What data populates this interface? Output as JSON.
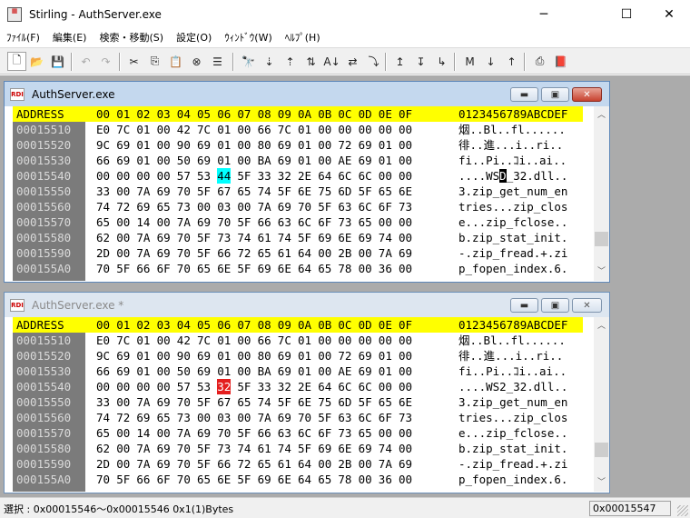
{
  "window": {
    "title": "Stirling - AuthServer.exe",
    "minimize_glyph": "─",
    "maximize_glyph": "☐",
    "close_glyph": "✕"
  },
  "menu": [
    "ﾌｧｲﾙ(F)",
    "編集(E)",
    "検索・移動(S)",
    "設定(O)",
    "ｳｨﾝﾄﾞｳ(W)",
    "ﾍﾙﾌﾟ(H)"
  ],
  "toolbar": {
    "buttons": [
      {
        "icon": "new-file-icon",
        "glyph": "🗋"
      },
      {
        "icon": "open-folder-icon",
        "glyph": "📂"
      },
      {
        "icon": "save-icon",
        "glyph": "💾"
      },
      {
        "icon": "undo-icon",
        "glyph": "↶"
      },
      {
        "icon": "redo-icon",
        "glyph": "↷"
      },
      {
        "icon": "cut-icon",
        "glyph": "✂"
      },
      {
        "icon": "copy-icon",
        "glyph": "⎘"
      },
      {
        "icon": "paste-icon",
        "glyph": "📋"
      },
      {
        "icon": "delete-icon",
        "glyph": "⊗"
      },
      {
        "icon": "list-icon",
        "glyph": "☰"
      },
      {
        "icon": "find-icon",
        "glyph": "🔭"
      },
      {
        "icon": "find-next-icon",
        "glyph": "⇣"
      },
      {
        "icon": "find-prev-icon",
        "glyph": "⇡"
      },
      {
        "icon": "find-all-icon",
        "glyph": "⇅"
      },
      {
        "icon": "replace-icon",
        "glyph": "A↓"
      },
      {
        "icon": "compare-icon",
        "glyph": "⇄"
      },
      {
        "icon": "jump-icon",
        "glyph": "⤵"
      },
      {
        "icon": "page-up-icon",
        "glyph": "↥"
      },
      {
        "icon": "page-down-icon",
        "glyph": "↧"
      },
      {
        "icon": "page-next-icon",
        "glyph": "↳"
      },
      {
        "icon": "mark-icon",
        "glyph": "M"
      },
      {
        "icon": "mark-next-icon",
        "glyph": "↓"
      },
      {
        "icon": "mark-prev-icon",
        "glyph": "↑"
      },
      {
        "icon": "print-icon",
        "glyph": "⎙"
      },
      {
        "icon": "help-book-icon",
        "glyph": "📕"
      }
    ]
  },
  "header": {
    "address": "ADDRESS",
    "cols": [
      "00",
      "01",
      "02",
      "03",
      "04",
      "05",
      "06",
      "07",
      "08",
      "09",
      "0A",
      "0B",
      "0C",
      "0D",
      "0E",
      "0F"
    ],
    "ascii": "0123456789ABCDEF"
  },
  "windows": [
    {
      "title": "AuthServer.exe",
      "state": "active",
      "rows": [
        {
          "addr": "00015510",
          "hex": [
            "E0",
            "7C",
            "01",
            "00",
            "42",
            "7C",
            "01",
            "00",
            "66",
            "7C",
            "01",
            "00",
            "00",
            "00",
            "00",
            "00"
          ],
          "ascii": "烟..Bl..fl......"
        },
        {
          "addr": "00015520",
          "hex": [
            "9C",
            "69",
            "01",
            "00",
            "90",
            "69",
            "01",
            "00",
            "80",
            "69",
            "01",
            "00",
            "72",
            "69",
            "01",
            "00"
          ],
          "ascii": "徘..進...i..ri.."
        },
        {
          "addr": "00015530",
          "hex": [
            "66",
            "69",
            "01",
            "00",
            "50",
            "69",
            "01",
            "00",
            "BA",
            "69",
            "01",
            "00",
            "AE",
            "69",
            "01",
            "00"
          ],
          "ascii": "fi..Pi..ｺi..ai.."
        },
        {
          "addr": "00015540",
          "hex": [
            "00",
            "00",
            "00",
            "00",
            "57",
            "53",
            "44",
            "5F",
            "33",
            "32",
            "2E",
            "64",
            "6C",
            "6C",
            "00",
            "00"
          ],
          "ascii": "....WSD_32.dll..",
          "highlight_col": 6
        },
        {
          "addr": "00015550",
          "hex": [
            "33",
            "00",
            "7A",
            "69",
            "70",
            "5F",
            "67",
            "65",
            "74",
            "5F",
            "6E",
            "75",
            "6D",
            "5F",
            "65",
            "6E"
          ],
          "ascii": "3.zip_get_num_en"
        },
        {
          "addr": "00015560",
          "hex": [
            "74",
            "72",
            "69",
            "65",
            "73",
            "00",
            "03",
            "00",
            "7A",
            "69",
            "70",
            "5F",
            "63",
            "6C",
            "6F",
            "73"
          ],
          "ascii": "tries...zip_clos"
        },
        {
          "addr": "00015570",
          "hex": [
            "65",
            "00",
            "14",
            "00",
            "7A",
            "69",
            "70",
            "5F",
            "66",
            "63",
            "6C",
            "6F",
            "73",
            "65",
            "00",
            "00"
          ],
          "ascii": "e...zip_fclose.."
        },
        {
          "addr": "00015580",
          "hex": [
            "62",
            "00",
            "7A",
            "69",
            "70",
            "5F",
            "73",
            "74",
            "61",
            "74",
            "5F",
            "69",
            "6E",
            "69",
            "74",
            "00"
          ],
          "ascii": "b.zip_stat_init."
        },
        {
          "addr": "00015590",
          "hex": [
            "2D",
            "00",
            "7A",
            "69",
            "70",
            "5F",
            "66",
            "72",
            "65",
            "61",
            "64",
            "00",
            "2B",
            "00",
            "7A",
            "69"
          ],
          "ascii": "-.zip_fread.+.zi"
        },
        {
          "addr": "000155A0",
          "hex": [
            "70",
            "5F",
            "66",
            "6F",
            "70",
            "65",
            "6E",
            "5F",
            "69",
            "6E",
            "64",
            "65",
            "78",
            "00",
            "36",
            "00"
          ],
          "ascii": "p_fopen_index.6."
        }
      ]
    },
    {
      "title": "AuthServer.exe *",
      "state": "inactive",
      "rows": [
        {
          "addr": "00015510",
          "hex": [
            "E0",
            "7C",
            "01",
            "00",
            "42",
            "7C",
            "01",
            "00",
            "66",
            "7C",
            "01",
            "00",
            "00",
            "00",
            "00",
            "00"
          ],
          "ascii": "烟..Bl..fl......"
        },
        {
          "addr": "00015520",
          "hex": [
            "9C",
            "69",
            "01",
            "00",
            "90",
            "69",
            "01",
            "00",
            "80",
            "69",
            "01",
            "00",
            "72",
            "69",
            "01",
            "00"
          ],
          "ascii": "徘..進...i..ri.."
        },
        {
          "addr": "00015530",
          "hex": [
            "66",
            "69",
            "01",
            "00",
            "50",
            "69",
            "01",
            "00",
            "BA",
            "69",
            "01",
            "00",
            "AE",
            "69",
            "01",
            "00"
          ],
          "ascii": "fi..Pi..ｺi..ai.."
        },
        {
          "addr": "00015540",
          "hex": [
            "00",
            "00",
            "00",
            "00",
            "57",
            "53",
            "32",
            "5F",
            "33",
            "32",
            "2E",
            "64",
            "6C",
            "6C",
            "00",
            "00"
          ],
          "ascii": "....WS2_32.dll..",
          "highlight_col": 6
        },
        {
          "addr": "00015550",
          "hex": [
            "33",
            "00",
            "7A",
            "69",
            "70",
            "5F",
            "67",
            "65",
            "74",
            "5F",
            "6E",
            "75",
            "6D",
            "5F",
            "65",
            "6E"
          ],
          "ascii": "3.zip_get_num_en"
        },
        {
          "addr": "00015560",
          "hex": [
            "74",
            "72",
            "69",
            "65",
            "73",
            "00",
            "03",
            "00",
            "7A",
            "69",
            "70",
            "5F",
            "63",
            "6C",
            "6F",
            "73"
          ],
          "ascii": "tries...zip_clos"
        },
        {
          "addr": "00015570",
          "hex": [
            "65",
            "00",
            "14",
            "00",
            "7A",
            "69",
            "70",
            "5F",
            "66",
            "63",
            "6C",
            "6F",
            "73",
            "65",
            "00",
            "00"
          ],
          "ascii": "e...zip_fclose.."
        },
        {
          "addr": "00015580",
          "hex": [
            "62",
            "00",
            "7A",
            "69",
            "70",
            "5F",
            "73",
            "74",
            "61",
            "74",
            "5F",
            "69",
            "6E",
            "69",
            "74",
            "00"
          ],
          "ascii": "b.zip_stat_init."
        },
        {
          "addr": "00015590",
          "hex": [
            "2D",
            "00",
            "7A",
            "69",
            "70",
            "5F",
            "66",
            "72",
            "65",
            "61",
            "64",
            "00",
            "2B",
            "00",
            "7A",
            "69"
          ],
          "ascii": "-.zip_fread.+.zi"
        },
        {
          "addr": "000155A0",
          "hex": [
            "70",
            "5F",
            "66",
            "6F",
            "70",
            "65",
            "6E",
            "5F",
            "69",
            "6E",
            "64",
            "65",
            "78",
            "00",
            "36",
            "00"
          ],
          "ascii": "p_fopen_index.6."
        }
      ]
    }
  ],
  "status": {
    "selection": "選択 : 0x00015546～0x00015546  0x1(1)Bytes",
    "position": "0x00015547"
  },
  "colors": {
    "header_bg": "#ffff00",
    "address_bg": "#7b7b7b",
    "highlight_active": "#00ffff",
    "highlight_inactive": "#e41e1e",
    "mdi_bg": "#ababab"
  }
}
